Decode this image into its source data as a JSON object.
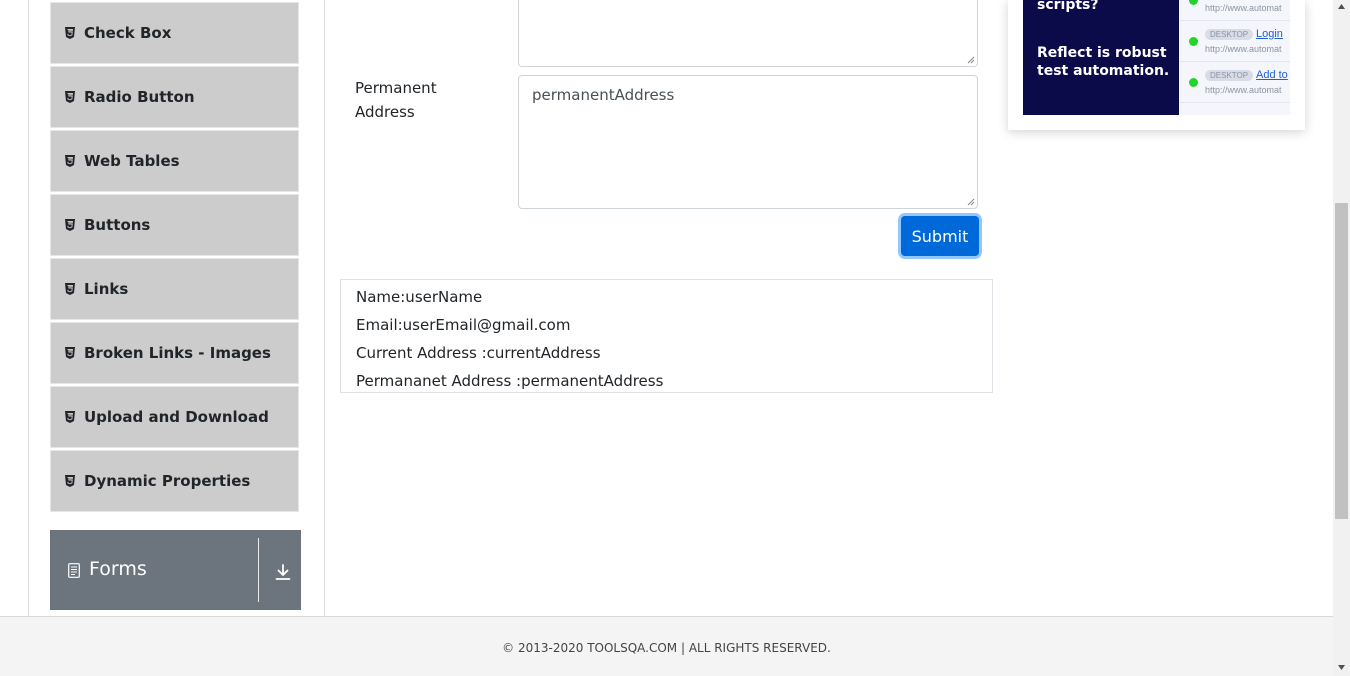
{
  "sidebar": {
    "items": [
      {
        "label": "Check Box",
        "icon": "html5-icon"
      },
      {
        "label": "Radio Button",
        "icon": "html5-icon"
      },
      {
        "label": "Web Tables",
        "icon": "html5-icon"
      },
      {
        "label": "Buttons",
        "icon": "html5-icon"
      },
      {
        "label": "Links",
        "icon": "html5-icon"
      },
      {
        "label": "Broken Links - Images",
        "icon": "html5-icon"
      },
      {
        "label": "Upload and Download",
        "icon": "html5-icon"
      },
      {
        "label": "Dynamic Properties",
        "icon": "html5-icon"
      }
    ],
    "group": {
      "label": "Forms",
      "icon": "document-icon",
      "toggle_icon": "download-arrow-icon"
    }
  },
  "form": {
    "current_address_value": "",
    "permanent_label": "Permanent Address",
    "permanent_value": "permanentAddress",
    "submit_label": "Submit"
  },
  "output": {
    "name": "Name:userName",
    "email": "Email:userEmail@gmail.com",
    "current": "Current Address :currentAddress",
    "permanent": "Permananet Address :permanentAddress"
  },
  "ad": {
    "question": "scripts?",
    "tagline": "Reflect is robust test automation.",
    "rows": [
      {
        "badge": "",
        "link": "",
        "url": "http://www.automat"
      },
      {
        "badge": "DESKTOP",
        "link": "Login",
        "url": "http://www.automat"
      },
      {
        "badge": "DESKTOP",
        "link": "Add to",
        "url": "http://www.automat"
      }
    ]
  },
  "footer": {
    "text": "© 2013-2020 TOOLSQA.COM | ALL RIGHTS RESERVED."
  },
  "colors": {
    "menu_bg": "#cccccc",
    "group_bg": "#6c757d",
    "primary": "#0069d9",
    "ad_bg": "#0b0b4a"
  }
}
